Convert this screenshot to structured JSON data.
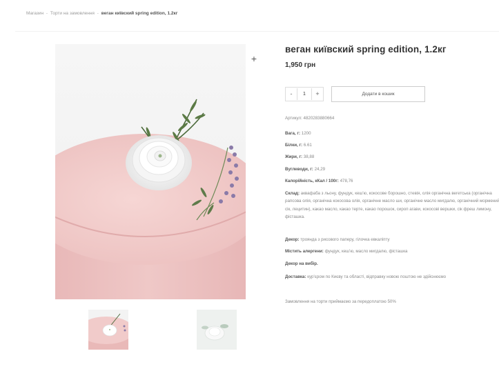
{
  "breadcrumb": {
    "items": [
      "Магазин",
      "Торти на замовлення"
    ],
    "separator": "-",
    "current": "веган київский spring edition, 1.2кг"
  },
  "product": {
    "title": "веган київский spring edition, 1.2кг",
    "price": "1,950 грн",
    "quantity": "1",
    "qty_minus": "-",
    "qty_plus": "+",
    "add_to_cart": "Додати в кошик",
    "zoom_icon": "+",
    "sku": {
      "label": "Артикул:",
      "value": "4820283880664"
    },
    "weight": {
      "label": "Вага, г:",
      "value": "1200"
    },
    "protein": {
      "label": "Білки, г:",
      "value": "6.61"
    },
    "fat": {
      "label": "Жири, г:",
      "value": "38,88"
    },
    "carbs": {
      "label": "Вуглеводи, г:",
      "value": "24,29"
    },
    "calories": {
      "label": "Калорійність, кКал / 100г:",
      "value": "478,76"
    },
    "composition": {
      "label": "Склад:",
      "value": "аквафаба з льону, фундук, кеш'ю, кокосове борошно, стевія, олія органічна вегетська (органічна рапсова олія, органічна кокосова олія, органічне масло ши, органічне масло мигдалю, органічний мормений сік, лецитин), какао масло, какао терте, какао порошок, сироп агави, кокосові вершки, сік фреш лимону, фісташка."
    },
    "decor": {
      "label": "Декор:",
      "value": "троянда з рисового паперу, гілочка евкаліпту"
    },
    "allergens": {
      "label": "Містить алергени:",
      "value": "фундук, кеш'ю, масло мигдалю, фісташка"
    },
    "decor_choice": "Декор на вибір.",
    "delivery": {
      "label": "Доставка:",
      "value": "кур'єром по Києву та області, відправку новою поштою не здійснюємо"
    },
    "prepayment": "Замовлення на торти приймаємо за передоплатою 50%"
  },
  "colors": {
    "cake_pink": "#eec5c4",
    "accent_text": "#333333"
  }
}
